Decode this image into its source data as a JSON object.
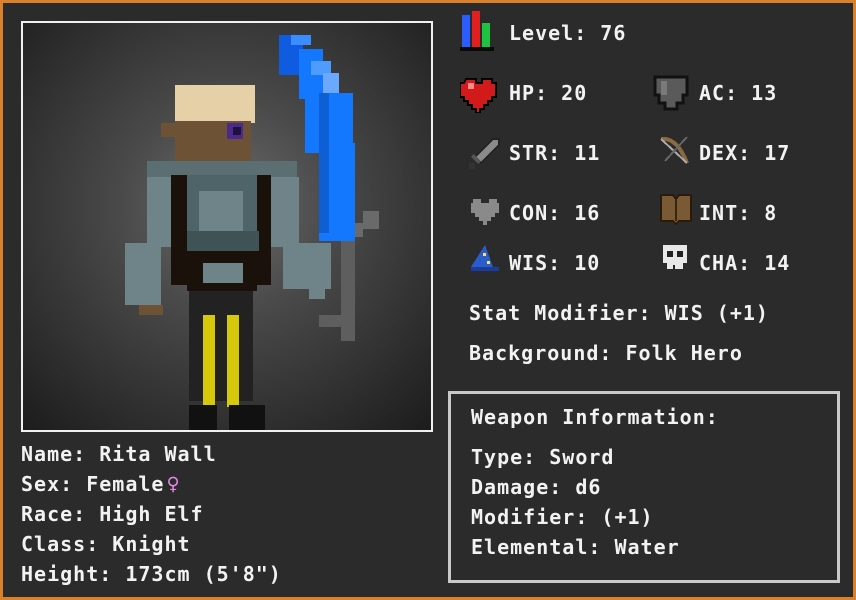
{
  "character": {
    "name": "Name: Rita Wall",
    "sex": "Sex: Female",
    "sex_symbol": "♀",
    "race": "Race: High Elf",
    "class": "Class: Knight",
    "height": "Height: 173cm (5'8\")"
  },
  "stats": {
    "level": "Level: 76",
    "hp": "HP: 20",
    "ac": "AC: 13",
    "str": "STR: 11",
    "dex": "DEX: 17",
    "con": "CON: 16",
    "int": "INT: 8",
    "wis": "WIS: 10",
    "cha": "CHA: 14",
    "modifier": "Stat Modifier: WIS (+1)",
    "background": "Background: Folk Hero"
  },
  "weapon": {
    "title": "Weapon Information:",
    "type": "Type: Sword",
    "damage": "Damage: d6",
    "modifier": "Modifier: (+1)",
    "elemental": "Elemental: Water"
  },
  "icons": [
    "level-bars-icon",
    "heart-icon",
    "shield-icon",
    "sword-icon",
    "bow-icon",
    "gray-heart-icon",
    "book-icon",
    "wizard-hat-icon",
    "skull-icon",
    "female-symbol-icon"
  ],
  "colors": {
    "border": "#d9822b",
    "background": "#2b2b2b",
    "text": "#f2f2f2",
    "blade": "#1478ff",
    "sex_symbol": "#e58ae6"
  }
}
